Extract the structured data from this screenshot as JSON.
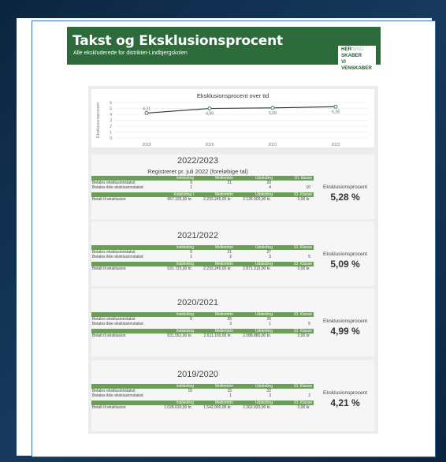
{
  "header": {
    "title": "Takst og Eksklusionsprocent",
    "subtitle": "Alle ekskluderede for distriktet-Lindbjergskolen"
  },
  "logo": {
    "line1_bold": "HER",
    "line1_light": "NING",
    "line2": "SKABER",
    "line3": "VI",
    "line4": "VENSKABER"
  },
  "chart_data": {
    "type": "line",
    "title": "Eksklusionsprocent over tid",
    "ylabel": "Eksklusionsprocent",
    "xlabel": "",
    "categories": [
      "2019",
      "2020",
      "2021",
      "2022"
    ],
    "values": [
      4.21,
      4.99,
      5.09,
      5.28
    ],
    "labels": [
      "4,21",
      "4,99",
      "5,09",
      "5,28"
    ],
    "yticks": [
      "0",
      "1",
      "2",
      "3",
      "4",
      "5",
      "6"
    ],
    "ylim": [
      0,
      6
    ],
    "grid": true,
    "line_color": "#2f3e46",
    "marker_color": "#3a8a3f"
  },
  "sections": [
    {
      "year": "2022/2023",
      "sub": "Registreret pr. juli 2022 (foreløbige tal)",
      "headers": [
        "Indskoling",
        "Mellemtrin",
        "Udskoling",
        "10. klasse"
      ],
      "rows": [
        {
          "label": "Betales eksklusionstakst",
          "values": [
            "9",
            "21",
            "20",
            ""
          ]
        },
        {
          "label": "Betales ikke eksklusionstakst",
          "values": [
            "1",
            "",
            "4",
            "10"
          ]
        }
      ],
      "headers2": [
        "Indskoling I",
        "Mellemtrin",
        "Udskoling",
        "10. Klasse"
      ],
      "pay": {
        "label": "Betalt til eksklusion",
        "values": [
          "957.105,00 kr.",
          "2.233.245,00 kr.",
          "2.126.900,00 kr.",
          "0,00 kr."
        ]
      },
      "ek_label": "Eksklusionsprocent",
      "ek_value": "5,28 %"
    },
    {
      "year": "2021/2022",
      "sub": "",
      "headers": [
        "Indskoling",
        "Mellemtrin",
        "Udskoling",
        "10. Klasse"
      ],
      "rows": [
        {
          "label": "Betales eksklusionstakst",
          "values": [
            "5",
            "21",
            "27",
            ""
          ]
        },
        {
          "label": "Betales ikke eksklusionstakst",
          "values": [
            "1",
            "2",
            "3",
            "5"
          ]
        }
      ],
      "headers2": [
        "Indskoling",
        "Mellemtrin",
        "Udskoling",
        "10. Klasse"
      ],
      "pay": {
        "label": "Betalt til eksklusion",
        "values": [
          "531.725,00 kr.",
          "2.233.245,00 kr.",
          "2.871.315,00 kr.",
          "0,00 kr."
        ]
      },
      "ek_label": "Eksklusionsprocent",
      "ek_value": "5,09 %"
    },
    {
      "year": "2020/2021",
      "sub": "",
      "headers": [
        "Indskoling",
        "Mellemtrin",
        "Udskoling",
        "10. Klasse"
      ],
      "rows": [
        {
          "label": "Betales eksklusionstakst",
          "values": [
            "6",
            "25",
            "20",
            ""
          ]
        },
        {
          "label": "Betales ikke eksklusionstakst",
          "values": [
            "",
            "3",
            "1",
            "5"
          ]
        }
      ],
      "headers2": [
        "Indskoling",
        "Mellemtrin",
        "Udskoling",
        "10. Klasse"
      ],
      "pay": {
        "label": "Betalt til eksklusion",
        "values": [
          "831.552,00 kr.",
          "2.611.100,00 kr.",
          "2.088.880,00 kr.",
          "0,00 kr."
        ]
      },
      "ek_label": "Eksklusionsprocent",
      "ek_value": "4,99 %"
    },
    {
      "year": "2019/2020",
      "sub": "",
      "headers": [
        "Indskoling",
        "Mellemtrin",
        "Udskoling",
        "10. Klasse"
      ],
      "rows": [
        {
          "label": "Betales eksklusionstakst",
          "values": [
            "10",
            "15",
            "22",
            ""
          ]
        },
        {
          "label": "Betales ikke eksklusionstakst",
          "values": [
            "",
            "1",
            "3",
            "2"
          ]
        }
      ],
      "headers2": [
        "Indskoling",
        "Mellemtrin",
        "Udskoling",
        "10. Klasse"
      ],
      "pay": {
        "label": "Betalt til eksklusion",
        "values": [
          "1.028.630,00 kr.",
          "1.542.900,00 kr.",
          "2.262.920,00 kr.",
          "0,00 kr."
        ]
      },
      "ek_label": "Eksklusionsprocent",
      "ek_value": "4,21 %"
    }
  ]
}
